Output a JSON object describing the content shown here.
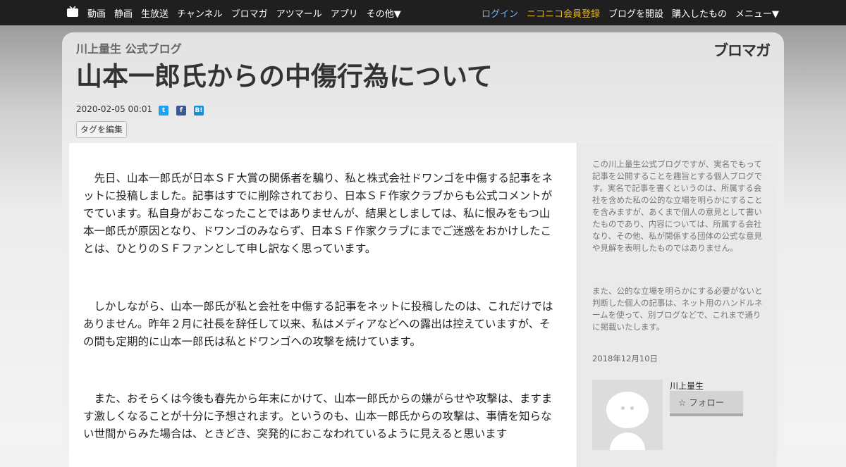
{
  "nav": {
    "left_items": [
      "動画",
      "静画",
      "生放送",
      "チャンネル",
      "ブロマガ",
      "アツマール",
      "アプリ",
      "その他▼"
    ],
    "login": "ログイン",
    "premium": "ニコニコ会員登録",
    "open_blog": "ブログを開設",
    "purchased": "購入したもの",
    "menu": "メニュー▼"
  },
  "blog": {
    "name": "川上量生 公式ブログ",
    "logo": "ブロマガ"
  },
  "article": {
    "title": "山本一郎氏からの中傷行為について",
    "date": "2020-02-05 00:01",
    "edit_tags": "タグを編集",
    "paragraphs": [
      "先日、山本一郎氏が日本ＳＦ大賞の関係者を騙り、私と株式会社ドワンゴを中傷する記事をネットに投稿しました。記事はすでに削除されており、日本ＳＦ作家クラブからも公式コメントがでています。私自身がおこなったことではありませんが、結果としましては、私に恨みをもつ山本一郎氏が原因となり、ドワンゴのみならず、日本ＳＦ作家クラブにまでご迷惑をおかけしたことは、ひとりのＳＦファンとして申し訳なく思っています。",
      "しかしながら、山本一郎氏が私と会社を中傷する記事をネットに投稿したのは、これだけではありません。昨年２月に社長を辞任して以来、私はメディアなどへの露出は控えていますが、その間も定期的に山本一郎氏は私とドワンゴへの攻撃を続けています。",
      "また、おそらくは今後も春先から年末にかけて、山本一郎氏からの嫌がらせや攻撃は、ますます激しくなることが十分に予想されます。というのも、山本一郎氏からの攻撃は、事情を知らない世間からみた場合は、ときどき、突発的におこなわれているように見えると思います"
    ]
  },
  "sidebar": {
    "about_1": "この川上量生公式ブログですが、実名でもって記事を公開することを趣旨とする個人ブログです。実名で記事を書くというのは、所属する会社を含めた私の公的な立場を明らかにすることを含みますが、あくまで個人の意見として書いたものであり、内容については、所属する会社なり、その他、私が関係する団体の公式な意見や見解を表明したものではありません。",
    "about_2": "また、公的な立場を明らかにする必要がないと判断した個人の記事は、ネット用のハンドルネームを使って、別ブログなどで、これまで通りに掲載いたします。",
    "date": "2018年12月10日",
    "author": "川上量生",
    "follow": "フォロー",
    "follow_icon": "star-outline-icon"
  }
}
